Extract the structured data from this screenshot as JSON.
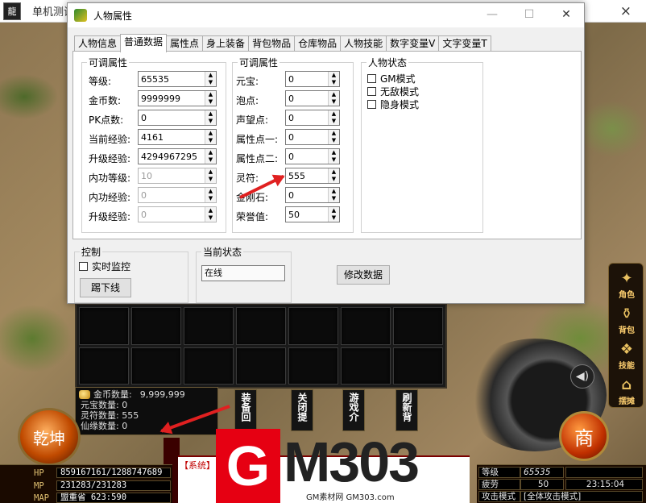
{
  "game": {
    "title": "单机测试",
    "app_icon": "龍",
    "close_glyph": "×",
    "currency": {
      "gold_label": "金币数量:",
      "gold_value": "9,999,999",
      "yuanbao": "元宝数量: 0",
      "lingfu": "灵符数量: 555",
      "xianyuan": "仙缘数量: 0"
    },
    "action_buttons": [
      "装备回",
      "关闭提",
      "游戏介",
      "刷新背"
    ],
    "chat_system": "【系统】",
    "left_orb": "乾坤",
    "shop": "商",
    "side_menu": [
      {
        "label": "角色",
        "icon": "character-icon",
        "glyph": "✦"
      },
      {
        "label": "背包",
        "icon": "bag-icon",
        "glyph": "⚱"
      },
      {
        "label": "技能",
        "icon": "scroll-icon",
        "glyph": "❖"
      },
      {
        "label": "摆摊",
        "icon": "stall-icon",
        "glyph": "⌂"
      }
    ],
    "stats_left": [
      {
        "label": "HP",
        "value": "859167161/1288747689"
      },
      {
        "label": "MP",
        "value": "231283/231283"
      },
      {
        "label": "MAP",
        "value": "盟重省 623:590"
      }
    ],
    "stats_right": {
      "level_label": "等级",
      "level_value": "65535",
      "fatigue_label": "疲劳",
      "fatigue_value": "50",
      "time": "23:15:04",
      "attack_mode_label": "攻击模式",
      "attack_mode_value": "[全体攻击模式]"
    }
  },
  "watermark": {
    "g": "G",
    "rest": "M303",
    "sub": "GM素材网 GM303.com"
  },
  "dialog": {
    "title": "人物属性",
    "controls": {
      "minimize": "—",
      "maximize": "☐",
      "close": "✕"
    },
    "tabs": [
      "人物信息",
      "普通数据",
      "属性点",
      "身上装备",
      "背包物品",
      "仓库物品",
      "人物技能",
      "数字变量V",
      "文字变量T"
    ],
    "active_tab": 1,
    "group_left": {
      "title": "可调属性",
      "rows": [
        {
          "label": "等级:",
          "value": "65535",
          "disabled": false
        },
        {
          "label": "金币数:",
          "value": "9999999",
          "disabled": false
        },
        {
          "label": "PK点数:",
          "value": "0",
          "disabled": false
        },
        {
          "label": "当前经验:",
          "value": "4161",
          "disabled": false
        },
        {
          "label": "升级经验:",
          "value": "4294967295",
          "disabled": false
        },
        {
          "label": "内功等级:",
          "value": "10",
          "disabled": true
        },
        {
          "label": "内功经验:",
          "value": "0",
          "disabled": true
        },
        {
          "label": "升级经验:",
          "value": "0",
          "disabled": true
        }
      ]
    },
    "group_mid": {
      "title": "可调属性",
      "rows": [
        {
          "label": "元宝:",
          "value": "0"
        },
        {
          "label": "泡点:",
          "value": "0"
        },
        {
          "label": "声望点:",
          "value": "0"
        },
        {
          "label": "属性点一:",
          "value": "0"
        },
        {
          "label": "属性点二:",
          "value": "0"
        },
        {
          "label": "灵符:",
          "value": "555"
        },
        {
          "label": "金刚石:",
          "value": "0"
        },
        {
          "label": "荣誉值:",
          "value": "50"
        }
      ]
    },
    "group_status": {
      "title": "人物状态",
      "checks": [
        "GM模式",
        "无敌模式",
        "隐身模式"
      ]
    },
    "control": {
      "title": "控制",
      "monitor_label": "实时监控",
      "kick_button": "踢下线"
    },
    "current_state": {
      "title": "当前状态",
      "value": "在线"
    },
    "modify_button": "修改数据"
  },
  "colors": {
    "annotation_arrow": "#e02020",
    "watermark_red": "#e60012"
  }
}
